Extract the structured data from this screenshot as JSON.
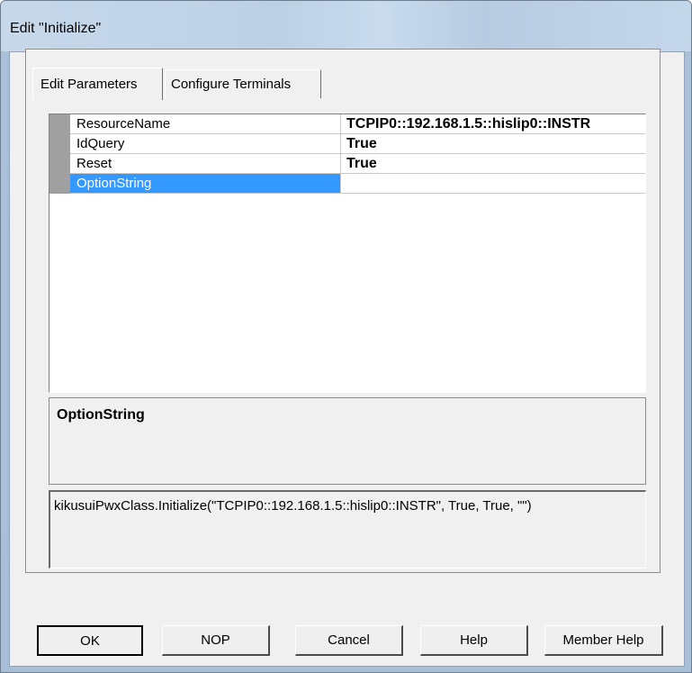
{
  "window": {
    "title": "Edit \"Initialize\""
  },
  "tabs": [
    {
      "label": "Edit Parameters",
      "active": true
    },
    {
      "label": "Configure Terminals",
      "active": false
    }
  ],
  "parameters": [
    {
      "name": "ResourceName",
      "value": "TCPIP0::192.168.1.5::hislip0::INSTR"
    },
    {
      "name": "IdQuery",
      "value": "True"
    },
    {
      "name": "Reset",
      "value": "True"
    },
    {
      "name": "OptionString",
      "value": "",
      "selected": true
    }
  ],
  "description": {
    "title": "OptionString"
  },
  "call_preview": "kikusuiPwxClass.Initialize(\"TCPIP0::192.168.1.5::hislip0::INSTR\", True, True, \"\")",
  "buttons": {
    "ok": "OK",
    "nop": "NOP",
    "cancel": "Cancel",
    "help": "Help",
    "member_help": "Member Help"
  },
  "colors": {
    "selection": "#3399ff",
    "gutter": "#a0a0a0"
  }
}
